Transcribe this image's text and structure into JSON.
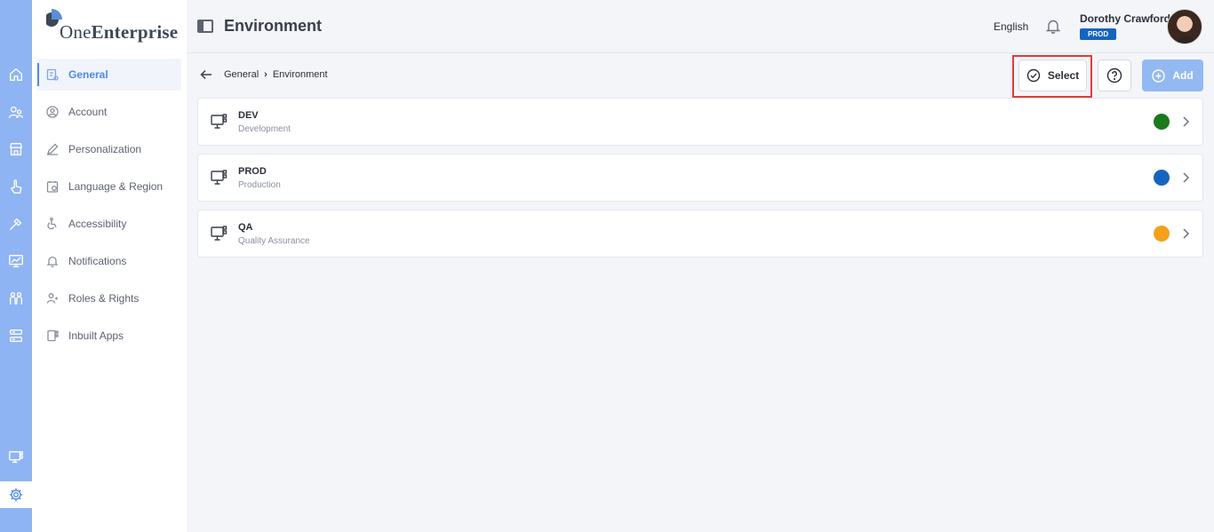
{
  "app": {
    "logo_prefix": "One",
    "logo_suffix": "Enterprise"
  },
  "rail": {
    "items": [
      {
        "name": "home-icon"
      },
      {
        "name": "users-icon"
      },
      {
        "name": "store-icon"
      },
      {
        "name": "hand-pointer-icon"
      },
      {
        "name": "tools-icon"
      },
      {
        "name": "monitor-chart-icon"
      },
      {
        "name": "people-icon"
      },
      {
        "name": "server-icon"
      },
      {
        "name": "monitor-grid-icon"
      },
      {
        "name": "gear-icon",
        "active": true
      }
    ]
  },
  "sidebar": {
    "items": [
      {
        "label": "General",
        "icon": "general-settings-icon",
        "active": true
      },
      {
        "label": "Account",
        "icon": "account-icon"
      },
      {
        "label": "Personalization",
        "icon": "pencil-icon"
      },
      {
        "label": "Language & Region",
        "icon": "language-icon"
      },
      {
        "label": "Accessibility",
        "icon": "accessibility-icon"
      },
      {
        "label": "Notifications",
        "icon": "bell-icon"
      },
      {
        "label": "Roles & Rights",
        "icon": "roles-icon"
      },
      {
        "label": "Inbuilt Apps",
        "icon": "apps-icon"
      }
    ]
  },
  "header": {
    "title": "Environment",
    "language": "English",
    "user_name": "Dorothy Crawford",
    "env_badge": "PROD"
  },
  "toolbar": {
    "breadcrumb": [
      "General",
      "Environment"
    ],
    "select_label": "Select",
    "add_label": "Add"
  },
  "environments": [
    {
      "code": "DEV",
      "name": "Development",
      "color": "#1b7a1b"
    },
    {
      "code": "PROD",
      "name": "Production",
      "color": "#1565c0"
    },
    {
      "code": "QA",
      "name": "Quality Assurance",
      "color": "#f5a01a"
    }
  ],
  "colors": {
    "accent": "#4d8ae8",
    "rail": "#8fb4f3",
    "add_button": "#93b9f3",
    "highlight": "#e03c3c"
  }
}
